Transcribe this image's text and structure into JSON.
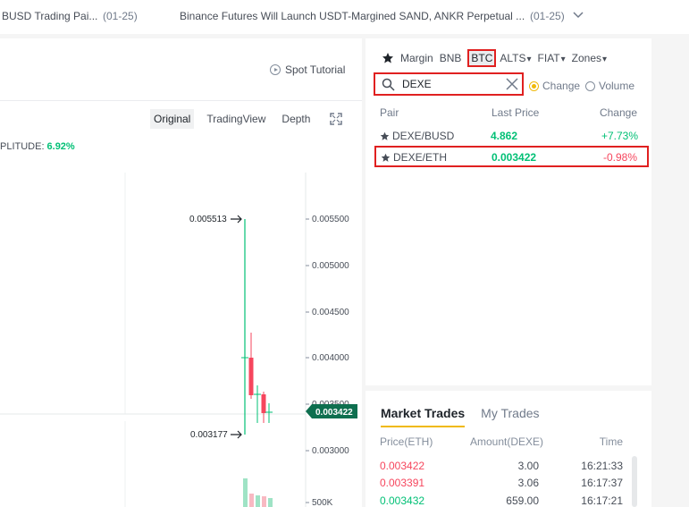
{
  "news": [
    {
      "title": "BUSD Trading Pai...",
      "date": "(01-25)"
    },
    {
      "title": "Binance Futures Will Launch USDT-Margined SAND, ANKR Perpetual ...",
      "date": "(01-25)"
    }
  ],
  "chart": {
    "tutorial_label": "Spot Tutorial",
    "view_tabs": [
      "Original",
      "TradingView",
      "Depth"
    ],
    "amplitude_label": "PLITUDE:",
    "amplitude_value": "6.92%",
    "price_axis": [
      "0.005500",
      "0.005000",
      "0.004500",
      "0.004000",
      "0.003500",
      "0.003000"
    ],
    "volume_axis": "500K",
    "high_label": "0.005513",
    "low_label": "0.003177",
    "current_price": "0.003422"
  },
  "market": {
    "quote_tabs": [
      "Margin",
      "BNB",
      "BTC",
      "ALTS",
      "FIAT",
      "Zones"
    ],
    "search_value": "DEXE",
    "radio_change": "Change",
    "radio_volume": "Volume",
    "headers": {
      "pair": "Pair",
      "last_price": "Last Price",
      "change": "Change"
    },
    "rows": [
      {
        "pair": "DEXE/BUSD",
        "price": "4.862",
        "change": "+7.73%"
      },
      {
        "pair": "DEXE/ETH",
        "price": "0.003422",
        "change": "-0.98%"
      }
    ]
  },
  "trades": {
    "tabs": [
      "Market Trades",
      "My Trades"
    ],
    "headers": {
      "price": "Price(ETH)",
      "amount": "Amount(DEXE)",
      "time": "Time"
    },
    "rows": [
      {
        "price": "0.003422",
        "amount": "3.00",
        "time": "16:21:33"
      },
      {
        "price": "0.003391",
        "amount": "3.06",
        "time": "16:17:37"
      },
      {
        "price": "0.003432",
        "amount": "659.00",
        "time": "16:17:21"
      }
    ]
  },
  "colors": {
    "up": "#02c076",
    "down": "#f6465d",
    "accent": "#f0b90b",
    "highlight": "#e02020",
    "price_tag": "#0e6f4f"
  }
}
